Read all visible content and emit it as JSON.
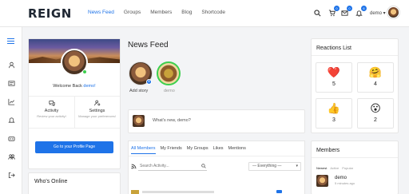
{
  "header": {
    "logo": "REIGN",
    "nav": [
      "News Feed",
      "Groups",
      "Members",
      "Blog",
      "Shortcode"
    ],
    "cart_count": "0",
    "messages_count": "0",
    "notifications_count": "6",
    "user_name": "demo",
    "accent": "#1e73e8"
  },
  "rail": {
    "icons": [
      "menu-icon",
      "user-icon",
      "activity-icon",
      "chart-icon",
      "bell-icon",
      "groups-icon",
      "members-icon",
      "logout-icon"
    ]
  },
  "profile_card": {
    "welcome_prefix": "Welcome Back",
    "user": "demo!",
    "activity": {
      "title": "Activity",
      "subtitle": "Review your activity!"
    },
    "settings": {
      "title": "Settings",
      "subtitle": "Manage your preferences!"
    },
    "button": "Go to your Profile Page"
  },
  "whos_online": {
    "title": "Who's Online"
  },
  "feed": {
    "title": "News Feed",
    "stories": [
      {
        "label": "Add story"
      },
      {
        "label": "demo"
      }
    ],
    "post_placeholder": "What's new, demo?",
    "tabs": [
      "All Members",
      "My Friends",
      "My Groups",
      "Likes",
      "Mentions"
    ],
    "search_placeholder": "Search Activity...",
    "filter": "— Everything —"
  },
  "reactions": {
    "title": "Reactions List",
    "items": [
      {
        "emoji": "❤️",
        "count": "5"
      },
      {
        "emoji": "🤗",
        "count": "4"
      },
      {
        "emoji": "👍",
        "count": "3"
      },
      {
        "emoji": "😮",
        "count": "2"
      }
    ]
  },
  "members": {
    "title": "Members",
    "tabs": [
      "Newest",
      "Active",
      "Popular"
    ],
    "member_name": "demo",
    "member_time": "5 minutes ago"
  }
}
